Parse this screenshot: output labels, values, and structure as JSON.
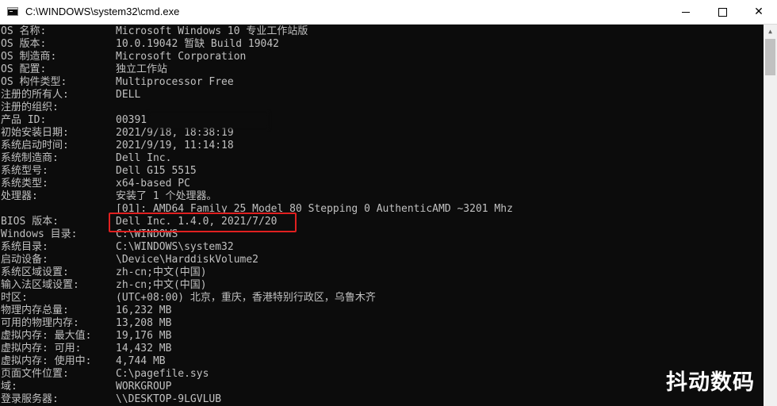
{
  "window": {
    "title": "C:\\WINDOWS\\system32\\cmd.exe",
    "icon": "console-icon",
    "controls": {
      "minimize": "minimize",
      "maximize": "maximize",
      "close": "✕"
    }
  },
  "console": {
    "lines": [
      {
        "label": "OS 名称:",
        "value": "Microsoft Windows 10 专业工作站版"
      },
      {
        "label": "OS 版本:",
        "value": "10.0.19042 暂缺 Build 19042"
      },
      {
        "label": "OS 制造商:",
        "value": "Microsoft Corporation"
      },
      {
        "label": "OS 配置:",
        "value": "独立工作站"
      },
      {
        "label": "OS 构件类型:",
        "value": "Multiprocessor Free"
      },
      {
        "label": "注册的所有人:",
        "value": "DELL"
      },
      {
        "label": "注册的组织:",
        "value": ""
      },
      {
        "label": "产品 ID:",
        "value": "00391"
      },
      {
        "label": "初始安装日期:",
        "value": "2021/9/18, 18:38:19"
      },
      {
        "label": "系统启动时间:",
        "value": "2021/9/19, 11:14:18"
      },
      {
        "label": "系统制造商:",
        "value": "Dell Inc."
      },
      {
        "label": "系统型号:",
        "value": "Dell G15 5515"
      },
      {
        "label": "系统类型:",
        "value": "x64-based PC"
      },
      {
        "label": "处理器:",
        "value": "安装了 1 个处理器。"
      },
      {
        "label": "",
        "value": "[01]: AMD64 Family 25 Model 80 Stepping 0 AuthenticAMD ~3201 Mhz"
      },
      {
        "label": "BIOS 版本:",
        "value": "Dell Inc. 1.4.0, 2021/7/20"
      },
      {
        "label": "Windows 目录:",
        "value": "C:\\WINDOWS"
      },
      {
        "label": "系统目录:",
        "value": "C:\\WINDOWS\\system32"
      },
      {
        "label": "启动设备:",
        "value": "\\Device\\HarddiskVolume2"
      },
      {
        "label": "系统区域设置:",
        "value": "zh-cn;中文(中国)"
      },
      {
        "label": "输入法区域设置:",
        "value": "zh-cn;中文(中国)"
      },
      {
        "label": "时区:",
        "value": "(UTC+08:00) 北京，重庆，香港特别行政区，乌鲁木齐"
      },
      {
        "label": "物理内存总量:",
        "value": "16,232 MB"
      },
      {
        "label": "可用的物理内存:",
        "value": "13,208 MB"
      },
      {
        "label": "虚拟内存: 最大值:",
        "value": "19,176 MB"
      },
      {
        "label": "虚拟内存: 可用:",
        "value": "14,432 MB"
      },
      {
        "label": "虚拟内存: 使用中:",
        "value": "4,744 MB"
      },
      {
        "label": "页面文件位置:",
        "value": "C:\\pagefile.sys"
      },
      {
        "label": "域:",
        "value": "WORKGROUP"
      },
      {
        "label": "登录服务器:",
        "value": "\\\\DESKTOP-9LGVLUB"
      }
    ]
  },
  "annotations": {
    "highlight_color": "#e02020",
    "highlighted_field": "BIOS 版本:"
  },
  "watermark": {
    "text": "抖动数码"
  }
}
